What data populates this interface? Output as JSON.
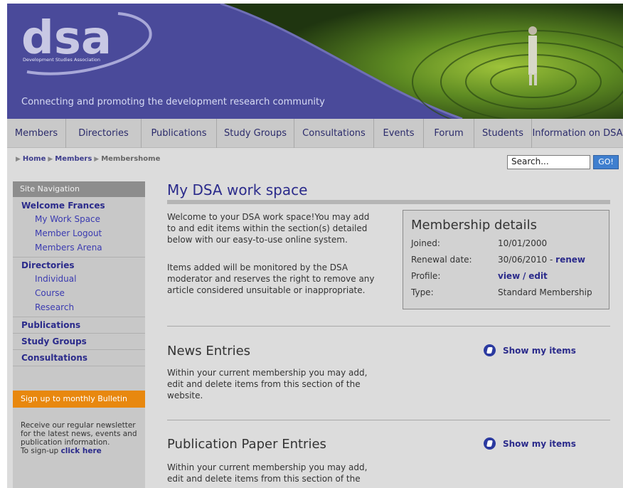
{
  "header": {
    "logo_text": "dsa",
    "logo_subtext": "Development Studies Association",
    "tagline": "Connecting and promoting the development research community"
  },
  "nav": {
    "items": [
      "Members",
      "Directories",
      "Publications",
      "Study Groups",
      "Consultations",
      "Events",
      "Forum",
      "Students",
      "Information on DSA"
    ]
  },
  "breadcrumb": {
    "items": [
      "Home",
      "Members",
      "Membershome"
    ]
  },
  "search": {
    "value": "Search...",
    "button_label": "GO!"
  },
  "sidebar": {
    "heading": "Site Navigation",
    "welcome": "Welcome Frances",
    "welcome_items": [
      "My Work Space",
      "Member Logout",
      "Members Arena"
    ],
    "directories": "Directories",
    "directory_items": [
      "Individual",
      "Course",
      "Research"
    ],
    "publications": "Publications",
    "study_groups": "Study Groups",
    "consultations": "Consultations",
    "bulletin_heading": "Sign up to monthly Bulletin",
    "bulletin_text": "Receive our regular newsletter for the latest news, events and publication information.",
    "signup_prefix": "To sign-up",
    "signup_link": "click here"
  },
  "main": {
    "title": "My DSA work space",
    "intro": "Welcome to your DSA work space!You may add to and edit items within the section(s) detailed below with our easy-to-use online system.",
    "notice": "Items added will be monitored by the DSA moderator and reserves the right to remove any article considered unsuitable or inappropriate.",
    "membership": {
      "title": "Membership details",
      "joined_label": "Joined:",
      "joined_value": "10/01/2000",
      "renewal_label": "Renewal date:",
      "renewal_value": "30/06/2010",
      "renewal_sep": "-",
      "renew_link": "renew",
      "profile_label": "Profile:",
      "view_link": "view",
      "profile_sep": "/",
      "edit_link": "edit",
      "type_label": "Type:",
      "type_value": "Standard Membership"
    },
    "sections": [
      {
        "title": "News Entries",
        "description": "Within your current membership you may add, edit and delete items from this section of the website.",
        "action": "Show my items"
      },
      {
        "title": "Publication Paper Entries",
        "description": "Within your current membership you may add, edit and delete items from this section of the",
        "action": "Show my items"
      }
    ]
  },
  "colors": {
    "header_purple": "#4a4a9a",
    "link_blue": "#2b2b8b",
    "bulletin_orange": "#e8880f",
    "go_button": "#3f7fcf"
  }
}
